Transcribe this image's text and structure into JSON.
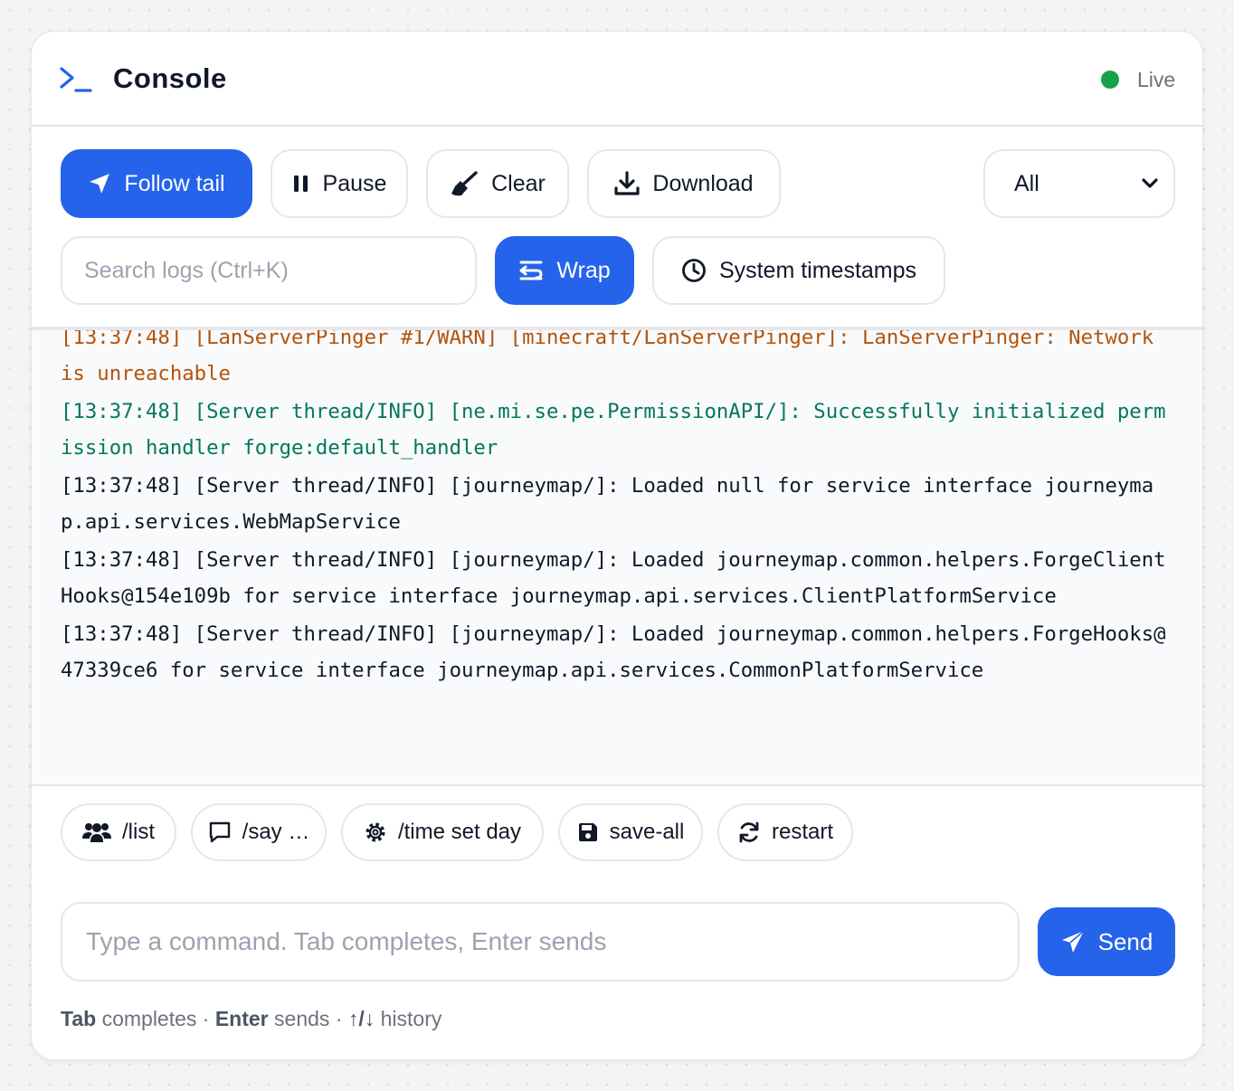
{
  "header": {
    "title": "Console",
    "status": "Live",
    "icon": "terminal-icon",
    "status_color": "#16a34a"
  },
  "toolbar": {
    "follow_label": "Follow tail",
    "pause_label": "Pause",
    "clear_label": "Clear",
    "download_label": "Download",
    "filter_value": "All",
    "search_placeholder": "Search logs (Ctrl+K)",
    "wrap_label": "Wrap",
    "timestamps_label": "System timestamps"
  },
  "logs": [
    {
      "level": "warn",
      "text": "[13:37:48] [LanServerPinger #1/WARN] [minecraft/LanServerPinger]: LanServerPinger: Network is unreachable"
    },
    {
      "level": "ok",
      "text": "[13:37:48] [Server thread/INFO] [ne.mi.se.pe.PermissionAPI/]: Successfully initialized permission handler forge:default_handler"
    },
    {
      "level": "info",
      "text": "[13:37:48] [Server thread/INFO] [journeymap/]: Loaded null for service interface journeymap.api.services.WebMapService"
    },
    {
      "level": "info",
      "text": "[13:37:48] [Server thread/INFO] [journeymap/]: Loaded journeymap.common.helpers.ForgeClientHooks@154e109b for service interface journeymap.api.services.ClientPlatformService"
    },
    {
      "level": "info",
      "text": "[13:37:48] [Server thread/INFO] [journeymap/]: Loaded journeymap.common.helpers.ForgeHooks@47339ce6 for service interface journeymap.api.services.CommonPlatformService"
    }
  ],
  "quick_commands": [
    {
      "label": "/list",
      "icon": "users-icon"
    },
    {
      "label": "/say …",
      "icon": "chat-bubble-icon"
    },
    {
      "label": "/time set day",
      "icon": "gear-icon"
    },
    {
      "label": "save-all",
      "icon": "floppy-disk-icon"
    },
    {
      "label": "restart",
      "icon": "refresh-icon"
    }
  ],
  "command": {
    "placeholder": "Type a command. Tab completes, Enter sends",
    "value": "",
    "send_label": "Send"
  },
  "hint": {
    "tab_key": "Tab",
    "tab_text": " completes · ",
    "enter_key": "Enter",
    "enter_text": " sends · ",
    "arrows_key": "↑/↓",
    "arrows_text": " history"
  },
  "colors": {
    "accent": "#2563eb",
    "warn": "#b45309",
    "success": "#047857",
    "live": "#16a34a"
  }
}
